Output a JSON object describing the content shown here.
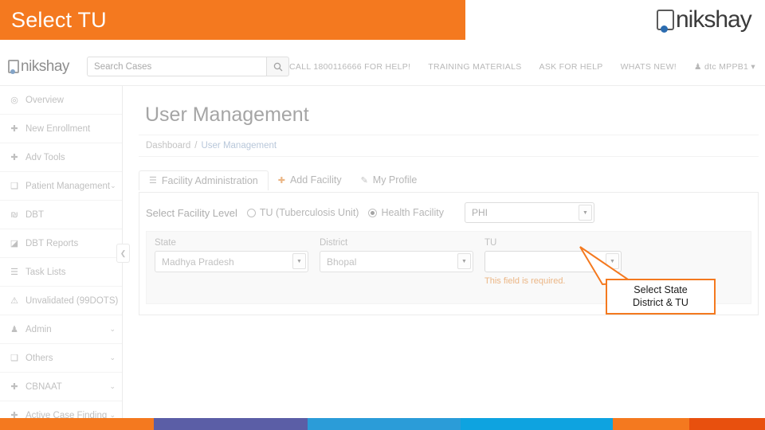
{
  "slide": {
    "title": "Select TU",
    "brand_logo_text": "nikshay",
    "banner_color": "#F4791F"
  },
  "navbar": {
    "logo_text": "nikshay",
    "search_placeholder": "Search Cases",
    "search_icon": "search-icon",
    "links": [
      "CALL 1800116666 FOR HELP!",
      "TRAINING MATERIALS",
      "ASK FOR HELP",
      "WHATS NEW!"
    ],
    "user": "dtc MPPB1",
    "user_icon": "user-icon",
    "user_caret": "▾"
  },
  "sidebar": {
    "collapse_icon": "chevron-left-icon",
    "items": [
      {
        "label": "Overview",
        "icon": "dashboard-icon",
        "glyph": "◎",
        "caret": ""
      },
      {
        "label": "New Enrollment",
        "icon": "plus-icon",
        "glyph": "✚",
        "caret": ""
      },
      {
        "label": "Adv Tools",
        "icon": "plus-icon",
        "glyph": "✚",
        "caret": ""
      },
      {
        "label": "Patient Management",
        "icon": "clipboard-icon",
        "glyph": "❑",
        "caret": "⌄"
      },
      {
        "label": "DBT",
        "icon": "money-icon",
        "glyph": "₪",
        "caret": ""
      },
      {
        "label": "DBT Reports",
        "icon": "chart-icon",
        "glyph": "◪",
        "caret": ""
      },
      {
        "label": "Task Lists",
        "icon": "list-icon",
        "glyph": "☰",
        "caret": ""
      },
      {
        "label": "Unvalidated (99DOTS)",
        "icon": "warning-icon",
        "glyph": "⚠",
        "caret": ""
      },
      {
        "label": "Admin",
        "icon": "user-icon",
        "glyph": "♟",
        "caret": "⌄"
      },
      {
        "label": "Others",
        "icon": "box-icon",
        "glyph": "❑",
        "caret": "⌄"
      },
      {
        "label": "CBNAAT",
        "icon": "plus-icon",
        "glyph": "✚",
        "caret": "⌄"
      },
      {
        "label": "Active Case Finding",
        "icon": "plus-icon",
        "glyph": "✚",
        "caret": "⌄"
      }
    ]
  },
  "main": {
    "page_title": "User Management",
    "breadcrumb": {
      "root": "Dashboard",
      "separator": "/",
      "current": "User Management"
    },
    "tabs": [
      {
        "label": "Facility Administration",
        "icon": "list-icon",
        "glyph": "☰",
        "active": true
      },
      {
        "label": "Add Facility",
        "icon": "plus-icon",
        "glyph": "✚",
        "active": false
      },
      {
        "label": "My Profile",
        "icon": "edit-icon",
        "glyph": "✎",
        "active": false
      }
    ],
    "facility_level": {
      "label": "Select Facility Level",
      "options": [
        {
          "label": "TU (Tuberculosis Unit)",
          "selected": false
        },
        {
          "label": "Health Facility",
          "selected": true
        }
      ],
      "phi_select": {
        "value": "PHI",
        "caret_icon": "chevron-down-icon"
      }
    },
    "fields": [
      {
        "name": "state",
        "label": "State",
        "value": "Madhya Pradesh",
        "caret_icon": "chevron-down-icon",
        "error": ""
      },
      {
        "name": "district",
        "label": "District",
        "value": "Bhopal",
        "caret_icon": "chevron-down-icon",
        "error": ""
      },
      {
        "name": "tu",
        "label": "TU",
        "value": "",
        "caret_icon": "chevron-down-icon",
        "error": "This field is required."
      }
    ]
  },
  "callout": {
    "line1": "Select State",
    "line2": "District & TU",
    "border_color": "#F4791F"
  },
  "footer_strip": {
    "colors": [
      "#F4791F",
      "#5B5EA6",
      "#2B9CD8",
      "#0EA3E0",
      "#F4791F",
      "#E8500E"
    ]
  }
}
